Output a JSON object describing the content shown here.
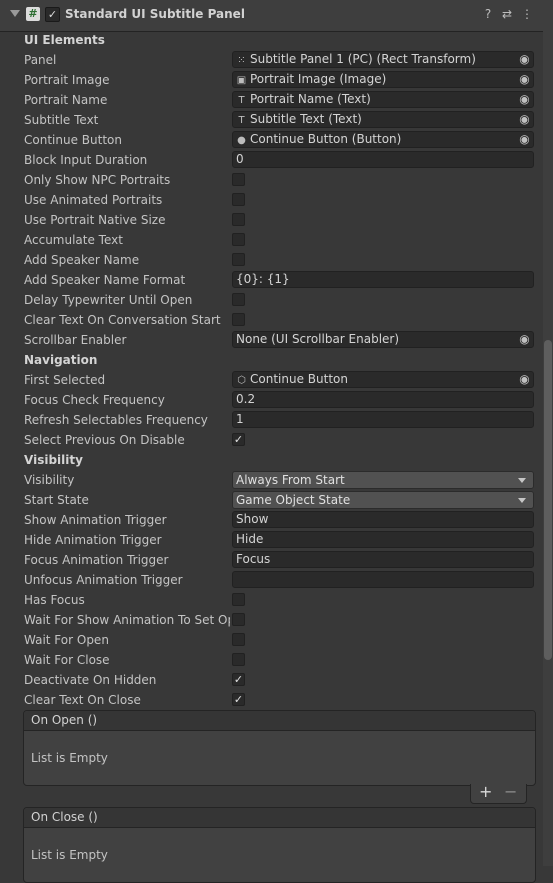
{
  "component": {
    "title": "Standard UI Subtitle Panel",
    "enabled_mark": "✓",
    "icons": [
      "help-icon",
      "presets-icon",
      "menu-icon"
    ]
  },
  "sections": [
    {
      "label": "UI Elements"
    },
    {
      "label": "Navigation"
    },
    {
      "label": "Visibility"
    }
  ],
  "fields": {
    "panel": {
      "label": "Panel",
      "value": "Subtitle Panel 1 (PC) (Rect Transform)",
      "icon": "rect-transform-icon"
    },
    "portrait_image": {
      "label": "Portrait Image",
      "value": "Portrait Image (Image)",
      "icon": "image-icon"
    },
    "portrait_name": {
      "label": "Portrait Name",
      "value": "Portrait Name (Text)",
      "icon": "text-icon"
    },
    "subtitle_text": {
      "label": "Subtitle Text",
      "value": "Subtitle Text (Text)",
      "icon": "text-icon"
    },
    "continue_button": {
      "label": "Continue Button",
      "value": "Continue Button (Button)",
      "icon": "button-icon"
    },
    "block_input_duration": {
      "label": "Block Input Duration",
      "value": "0"
    },
    "only_show_npc_portraits": {
      "label": "Only Show NPC Portraits",
      "checked": false
    },
    "use_animated_portraits": {
      "label": "Use Animated Portraits",
      "checked": false
    },
    "use_portrait_native_size": {
      "label": "Use Portrait Native Size",
      "checked": false
    },
    "accumulate_text": {
      "label": "Accumulate Text",
      "checked": false
    },
    "add_speaker_name": {
      "label": "Add Speaker Name",
      "checked": false
    },
    "add_speaker_name_format": {
      "label": "Add Speaker Name Format",
      "value": "{0}: {1}"
    },
    "delay_typewriter_until_open": {
      "label": "Delay Typewriter Until Open",
      "checked": false
    },
    "clear_text_on_conversation_start": {
      "label": "Clear Text On Conversation Start",
      "checked": false
    },
    "scrollbar_enabler": {
      "label": "Scrollbar Enabler",
      "value": "None (UI Scrollbar Enabler)"
    },
    "first_selected": {
      "label": "First Selected",
      "value": "Continue Button",
      "icon": "gameobject-icon"
    },
    "focus_check_frequency": {
      "label": "Focus Check Frequency",
      "value": "0.2"
    },
    "refresh_selectables_frequency": {
      "label": "Refresh Selectables Frequency",
      "value": "1"
    },
    "select_previous_on_disable": {
      "label": "Select Previous On Disable",
      "checked": true
    },
    "visibility": {
      "label": "Visibility",
      "value": "Always From Start"
    },
    "start_state": {
      "label": "Start State",
      "value": "Game Object State"
    },
    "show_animation_trigger": {
      "label": "Show Animation Trigger",
      "value": "Show"
    },
    "hide_animation_trigger": {
      "label": "Hide Animation Trigger",
      "value": "Hide"
    },
    "focus_animation_trigger": {
      "label": "Focus Animation Trigger",
      "value": "Focus"
    },
    "unfocus_animation_trigger": {
      "label": "Unfocus Animation Trigger",
      "value": ""
    },
    "has_focus": {
      "label": "Has Focus",
      "checked": false
    },
    "wait_for_show_animation": {
      "label": "Wait For Show Animation To Set Ope",
      "checked": false
    },
    "wait_for_open": {
      "label": "Wait For Open",
      "checked": false
    },
    "wait_for_close": {
      "label": "Wait For Close",
      "checked": false
    },
    "deactivate_on_hidden": {
      "label": "Deactivate On Hidden",
      "checked": true
    },
    "clear_text_on_close": {
      "label": "Clear Text On Close",
      "checked": true
    }
  },
  "check_glyph": "✓",
  "events": {
    "on_open": {
      "header": "On Open ()",
      "empty_text": "List is Empty"
    },
    "on_close": {
      "header": "On Close ()",
      "empty_text": "List is Empty"
    }
  },
  "list_controls": {
    "add": "+",
    "remove": "−"
  }
}
